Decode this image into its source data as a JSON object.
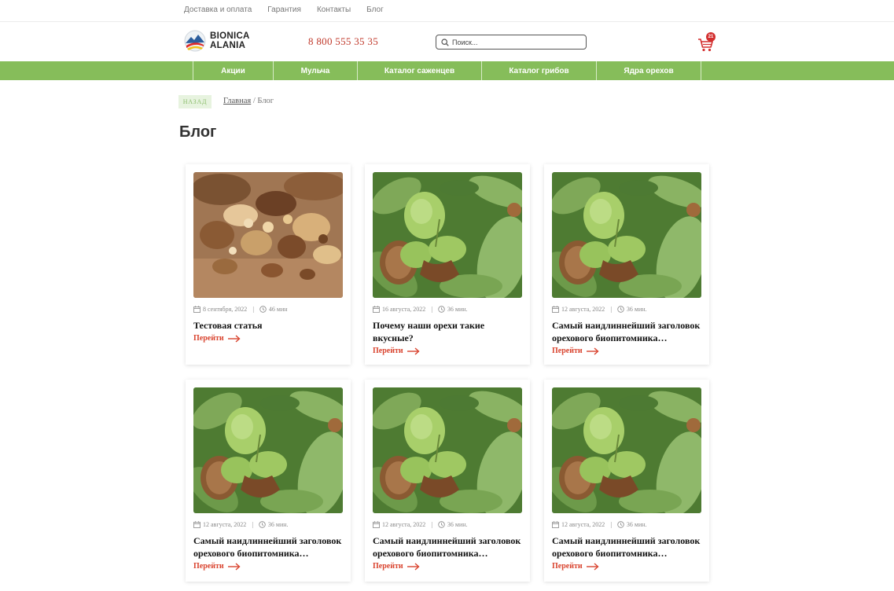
{
  "top_links": [
    "Доставка и оплата",
    "Гарантия",
    "Контакты",
    "Блог"
  ],
  "logo": {
    "line1": "BIONICA",
    "line2": "ALANIA"
  },
  "phone": "8 800 555 35 35",
  "search": {
    "placeholder": "Поиск..."
  },
  "cart": {
    "count": "21",
    "icon": "cart-icon"
  },
  "nav": [
    "Акции",
    "Мульча",
    "Каталог саженцев",
    "Каталог грибов",
    "Ядра орехов"
  ],
  "back_label": "НАЗАД",
  "breadcrumb": {
    "home": "Главная",
    "separator": " / ",
    "current": "Блог"
  },
  "page_title": "Блог",
  "posts": [
    {
      "date": "8 сентября, 2022",
      "read_time": "46 мин",
      "title": "Тестовая статья",
      "more": "Перейти",
      "image": "mixed-nuts-photo"
    },
    {
      "date": "16 августа, 2022",
      "read_time": "36 мин.",
      "title": "Почему наши орехи такие вкусные?",
      "more": "Перейти",
      "image": "walnut-tree-photo"
    },
    {
      "date": "12 августа, 2022",
      "read_time": "36 мин.",
      "title": "Самый наидлиннейший заголовок орехового биопитомника…",
      "more": "Перейти",
      "image": "walnut-tree-photo"
    },
    {
      "date": "12 августа, 2022",
      "read_time": "36 мин.",
      "title": "Самый наидлиннейший заголовок орехового биопитомника…",
      "more": "Перейти",
      "image": "walnut-tree-photo"
    },
    {
      "date": "12 августа, 2022",
      "read_time": "36 мин.",
      "title": "Самый наидлиннейший заголовок орехового биопитомника…",
      "more": "Перейти",
      "image": "walnut-tree-photo"
    },
    {
      "date": "12 августа, 2022",
      "read_time": "36 мин.",
      "title": "Самый наидлиннейший заголовок орехового биопитомника…",
      "more": "Перейти",
      "image": "walnut-tree-photo"
    }
  ],
  "colors": {
    "nav_green": "#86bd5a",
    "accent_red": "#d9442f",
    "phone_red": "#c0392b"
  }
}
